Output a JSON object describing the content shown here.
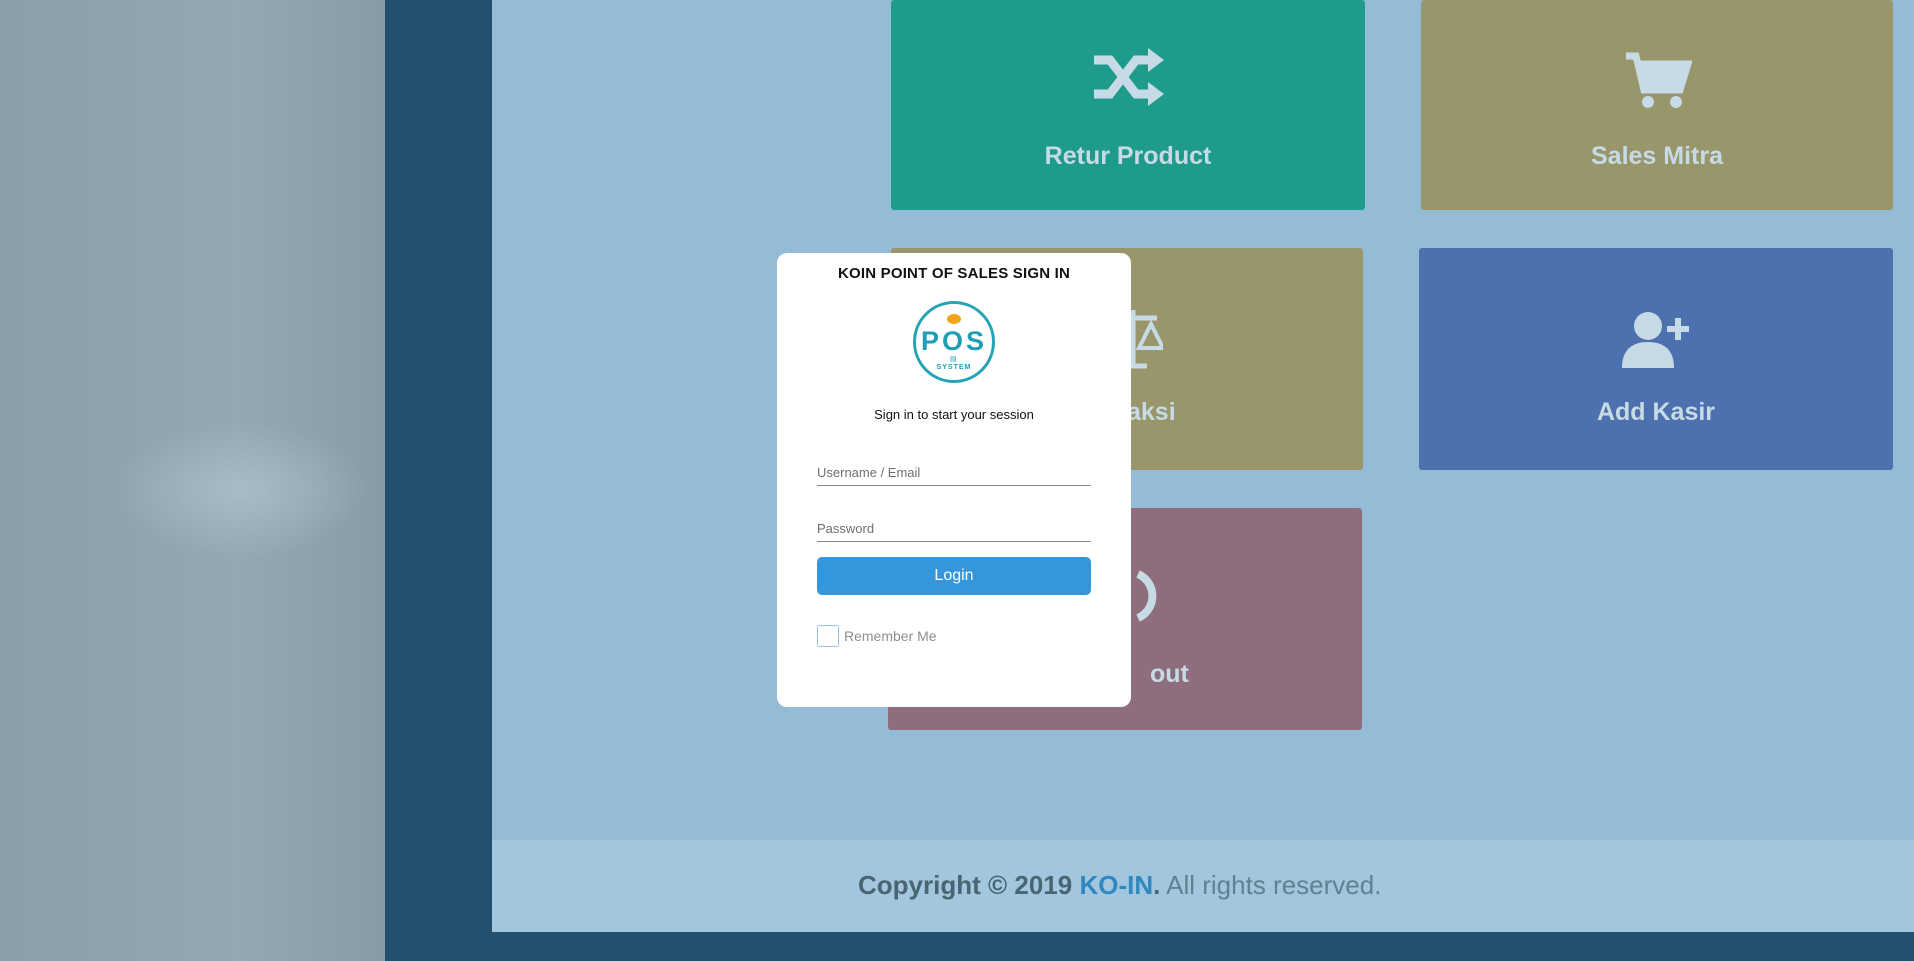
{
  "background": {
    "tiles": [
      {
        "key": "retur",
        "label": "Retur Product",
        "icon": "shuffle-icon"
      },
      {
        "key": "sales",
        "label": "Sales Mitra",
        "icon": "cart-icon"
      },
      {
        "key": "trans",
        "label": "aksi",
        "icon": "balance-scale-icon"
      },
      {
        "key": "kasir",
        "label": "Add Kasir",
        "icon": "user-plus-icon"
      },
      {
        "key": "logout",
        "label": "out",
        "icon": "power-icon"
      }
    ],
    "footer": {
      "copyright": "Copyright © 2019 ",
      "brand": "KO-IN",
      "dot": ".",
      "rights": " All rights reserved."
    }
  },
  "login": {
    "title": "KOIN POINT OF SALES SIGN IN",
    "logo": {
      "main": "POS",
      "sub": "SYSTEM"
    },
    "subtitle": "Sign in to start your session",
    "username_placeholder": "Username / Email",
    "username_value": "",
    "password_placeholder": "Password",
    "password_value": "",
    "login_label": "Login",
    "remember_label": "Remember Me",
    "remember_checked": false
  },
  "colors": {
    "accent": "#3497db",
    "logo": "#25a4b6",
    "overlay": "#95bcd7"
  }
}
